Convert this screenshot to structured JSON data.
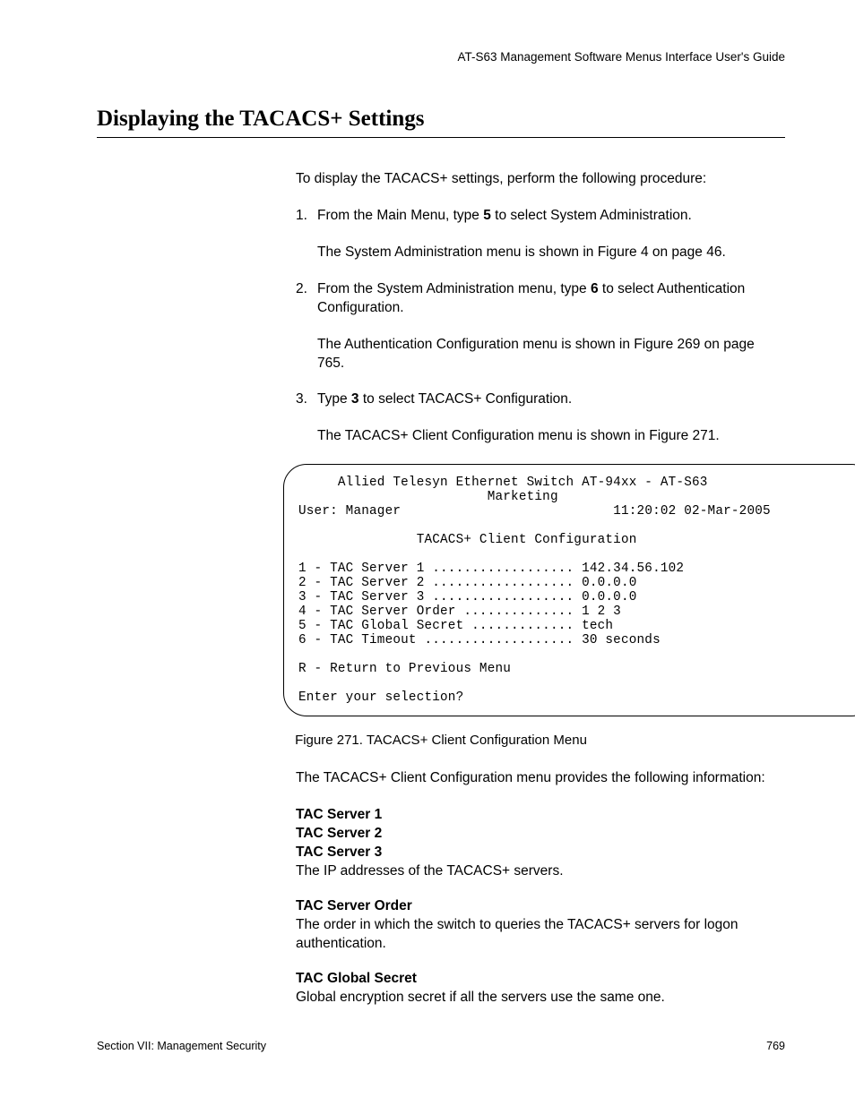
{
  "header": "AT-S63 Management Software Menus Interface User's Guide",
  "title": "Displaying the TACACS+ Settings",
  "intro": "To display the TACACS+ settings, perform the following procedure:",
  "steps": {
    "s1_pre": "From the Main Menu, type ",
    "s1_bold": "5",
    "s1_post": " to select System Administration.",
    "s1_note": "The System Administration menu is shown in Figure 4 on page 46.",
    "s2_pre": "From the System Administration menu, type ",
    "s2_bold": "6",
    "s2_post": " to select Authentication Configuration.",
    "s2_note": "The Authentication Configuration menu is shown in Figure 269 on page 765.",
    "s3_pre": "Type ",
    "s3_bold": "3",
    "s3_post": " to select TACACS+ Configuration.",
    "s3_note": "The TACACS+ Client Configuration menu is shown in Figure 271."
  },
  "menu": {
    "line1": "     Allied Telesyn Ethernet Switch AT-94xx - AT-S63",
    "line2": "                        Marketing",
    "user_label": "User: Manager",
    "timestamp": "11:20:02 02-Mar-2005",
    "menu_title": "               TACACS+ Client Configuration",
    "items": [
      "1 - TAC Server 1 .................. 142.34.56.102",
      "2 - TAC Server 2 .................. 0.0.0.0",
      "3 - TAC Server 3 .................. 0.0.0.0",
      "4 - TAC Server Order .............. 1 2 3",
      "5 - TAC Global Secret ............. tech",
      "6 - TAC Timeout ................... 30 seconds"
    ],
    "return_line": "R - Return to Previous Menu",
    "prompt": "Enter your selection?"
  },
  "fig_caption": "Figure 271. TACACS+ Client Configuration Menu",
  "after_fig": "The TACACS+ Client Configuration menu provides the following information:",
  "defs": {
    "d1a": "TAC Server 1",
    "d1b": "TAC Server 2",
    "d1c": "TAC Server 3",
    "d1body": "The IP addresses of the TACACS+ servers.",
    "d2": "TAC Server Order",
    "d2body": "The order in which the switch to queries the TACACS+ servers for logon authentication.",
    "d3": "TAC Global Secret",
    "d3body": "Global encryption secret if all the servers use the same one."
  },
  "footer_left": "Section VII: Management Security",
  "footer_right": "769"
}
